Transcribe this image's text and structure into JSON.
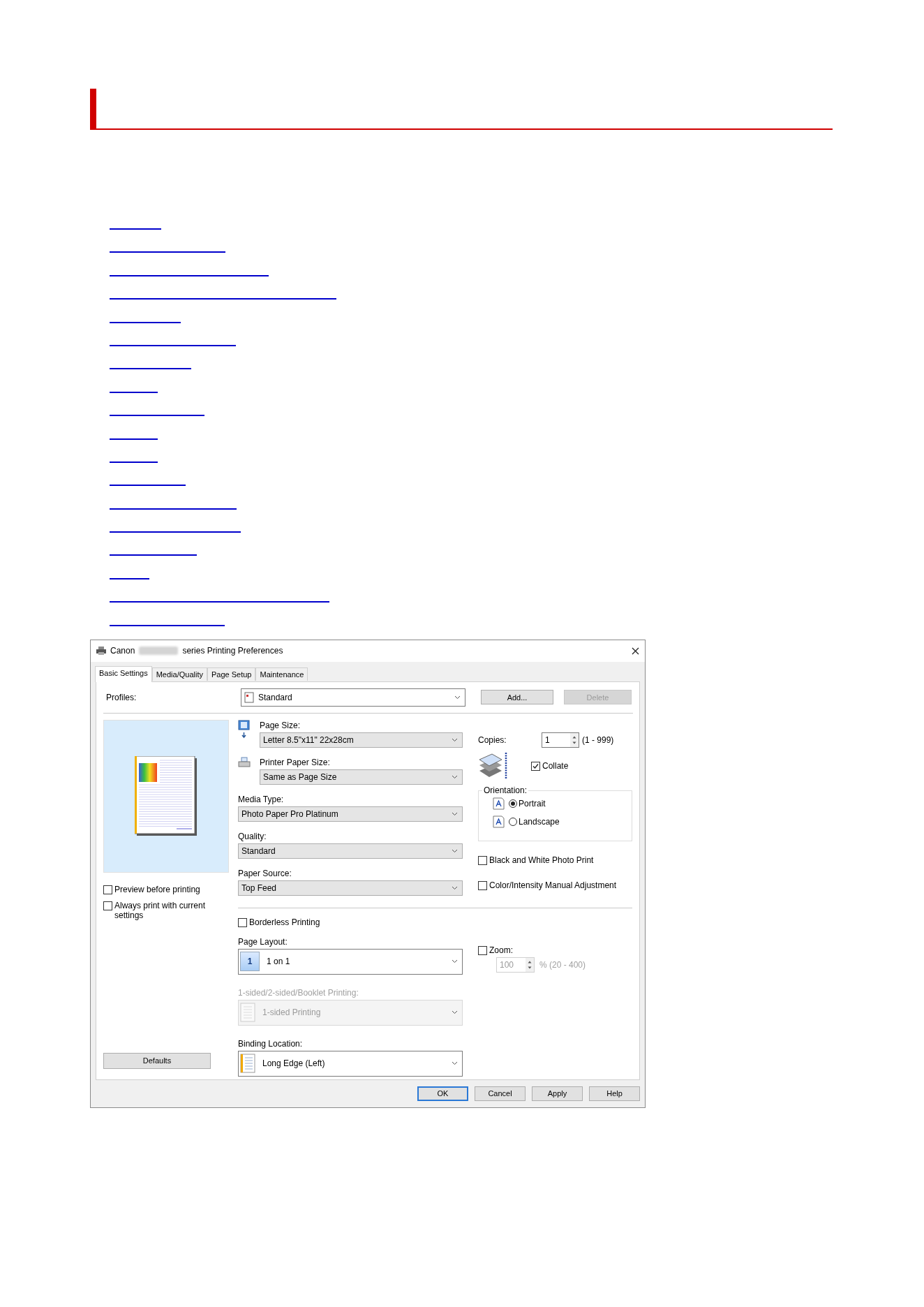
{
  "dialog": {
    "title_start": "Canon",
    "title_end": "series Printing Preferences",
    "tabs": [
      {
        "label": "Basic Settings",
        "selected": true
      },
      {
        "label": "Media/Quality",
        "selected": false
      },
      {
        "label": "Page Setup",
        "selected": false
      },
      {
        "label": "Maintenance",
        "selected": false
      }
    ],
    "profiles": {
      "label": "Profiles:",
      "value": "Standard"
    },
    "profile_buttons": [
      {
        "label": "Add...",
        "disabled": false
      },
      {
        "label": "Delete",
        "disabled": true
      }
    ],
    "paper_fields": [
      {
        "label": "Page Size:",
        "value": "Letter 8.5\"x11\" 22x28cm",
        "kind": "page-size"
      },
      {
        "label": "Printer Paper Size:",
        "value": "Same as Page Size",
        "kind": "printer-paper"
      },
      {
        "label": "Media Type:",
        "value": "Photo Paper Pro Platinum",
        "kind": "plain"
      },
      {
        "label": "Quality:",
        "value": "Standard",
        "kind": "plain"
      },
      {
        "label": "Paper Source:",
        "value": "Top Feed",
        "kind": "plain"
      }
    ],
    "preview_options": [
      {
        "label": "Preview before printing",
        "checked": false
      },
      {
        "label": "Always print with current settings",
        "checked": false
      }
    ],
    "defaults_button": "Defaults",
    "copies": {
      "label": "Copies:",
      "value": "1",
      "range": "(1 - 999)"
    },
    "collate": {
      "label": "Collate",
      "checked": true
    },
    "orientation": {
      "label": "Orientation:",
      "options": [
        {
          "label": "Portrait",
          "selected": true
        },
        {
          "label": "Landscape",
          "selected": false
        }
      ]
    },
    "color_options": [
      {
        "label": "Black and White Photo Print",
        "checked": false
      },
      {
        "label": "Color/Intensity Manual Adjustment",
        "checked": false
      }
    ],
    "borderless": {
      "label": "Borderless Printing",
      "checked": false
    },
    "layout_fields": [
      {
        "label": "Page Layout:",
        "value": "1 on 1",
        "icon_text": "1",
        "kind": "layout",
        "disabled": false
      },
      {
        "label": "1-sided/2-sided/Booklet Printing:",
        "value": "1-sided Printing",
        "kind": "sided",
        "disabled": true
      },
      {
        "label": "Binding Location:",
        "value": "Long Edge (Left)",
        "kind": "binding",
        "disabled": false
      }
    ],
    "zoom": {
      "label": "Zoom:",
      "checked": false,
      "value": "100",
      "range": "% (20 - 400)",
      "disabled": true
    },
    "footer_buttons": [
      {
        "label": "OK",
        "default": true
      },
      {
        "label": "Cancel",
        "default": false
      },
      {
        "label": "Apply",
        "default": false
      },
      {
        "label": "Help",
        "default": false
      }
    ]
  }
}
